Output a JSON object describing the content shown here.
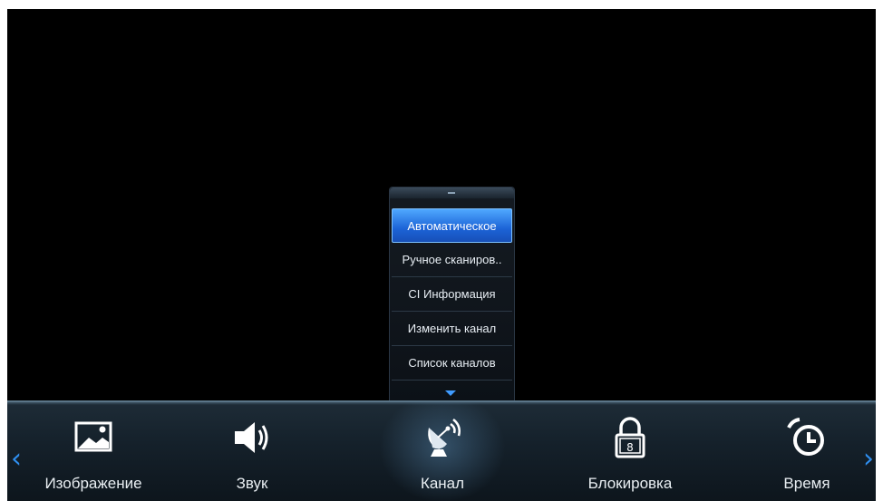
{
  "submenu": {
    "items": [
      {
        "label": "Автоматическое",
        "selected": true
      },
      {
        "label": "Ручное сканиров..",
        "selected": false
      },
      {
        "label": "CI Информация",
        "selected": false
      },
      {
        "label": "Изменить канал",
        "selected": false
      },
      {
        "label": "Список каналов",
        "selected": false
      }
    ],
    "scroll_down_icon": "triangle-down-icon"
  },
  "main_menu": {
    "items": [
      {
        "label": "Изображение",
        "icon": "picture-icon"
      },
      {
        "label": "Звук",
        "icon": "speaker-icon"
      },
      {
        "label": "Канал",
        "icon": "satellite-dish-icon",
        "active": true
      },
      {
        "label": "Блокировка",
        "icon": "lock-icon"
      },
      {
        "label": "Время",
        "icon": "alarm-clock-icon"
      }
    ],
    "left_arrow": "‹",
    "right_arrow": "›"
  },
  "colors": {
    "accent": "#2f8ff0",
    "selection": "#1c63d6",
    "background": "#000000"
  }
}
